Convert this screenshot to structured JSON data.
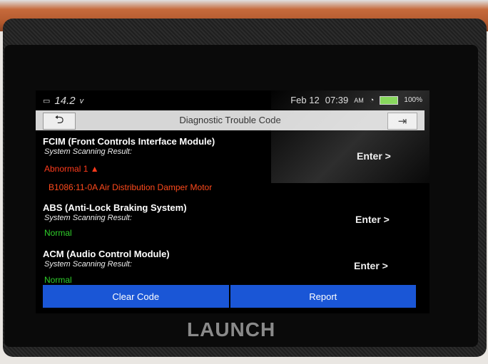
{
  "status_bar": {
    "voltage": "14.2",
    "voltage_unit": "v",
    "date": "Feb 12",
    "time": "07:39",
    "ampm": "AM",
    "battery": "100%"
  },
  "title_bar": {
    "back_icon": "back-arrow-icon",
    "title": "Diagnostic Trouble Code",
    "exit_icon": "exit-icon"
  },
  "modules": [
    {
      "name": "FCIM (Front Controls Interface Module)",
      "label": "System Scanning Result:",
      "status": "Abnormal 1",
      "status_type": "abnormal",
      "enter": "Enter >",
      "dtc": "B1086:11-0A Air Distribution Damper Motor"
    },
    {
      "name": "ABS (Anti-Lock Braking System)",
      "label": "System Scanning Result:",
      "status": "Normal",
      "status_type": "normal",
      "enter": "Enter >"
    },
    {
      "name": "ACM (Audio Control Module)",
      "label": "System Scanning Result:",
      "status": "Normal",
      "status_type": "normal",
      "enter": "Enter >"
    }
  ],
  "buttons": {
    "clear": "Clear Code",
    "report": "Report"
  },
  "brand": "LAUNCH",
  "colors": {
    "abnormal": "#ff3b1c",
    "normal": "#2fcf2a",
    "button": "#1a56d6"
  }
}
